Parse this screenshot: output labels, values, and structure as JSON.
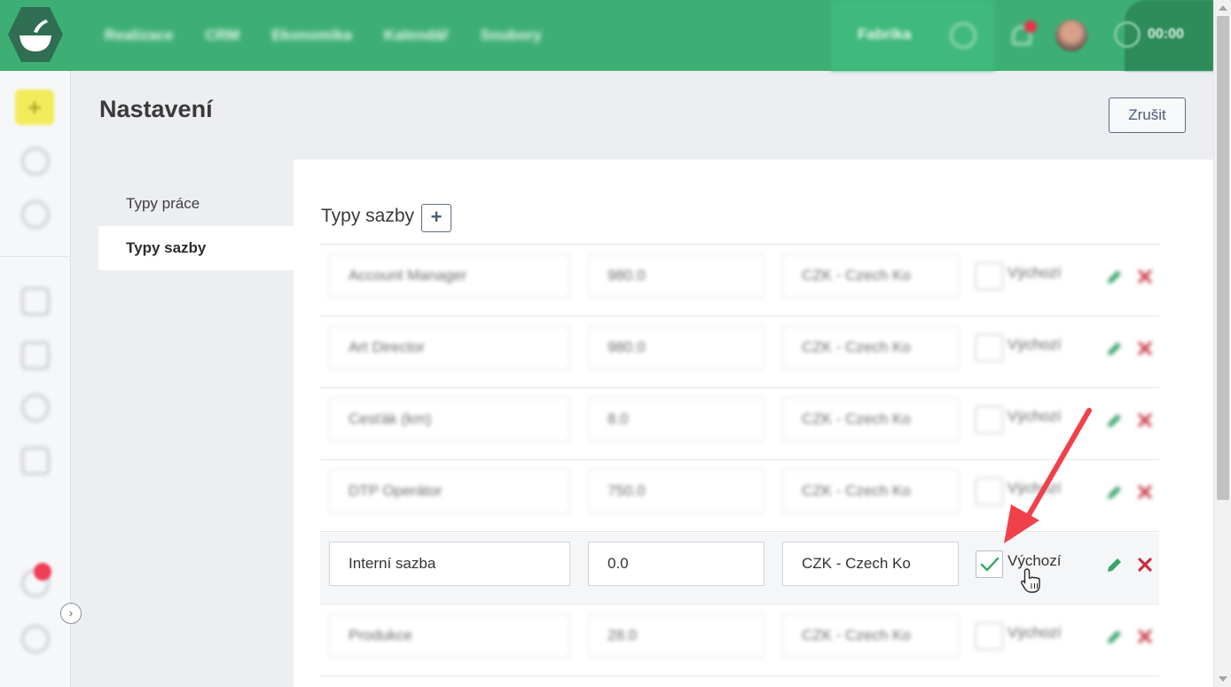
{
  "topbar": {
    "nav": [
      "Realizace",
      "CRM",
      "Ekonomika",
      "Kalendář",
      "Soubory"
    ],
    "company": "Fabrika",
    "timer": "00:00"
  },
  "page": {
    "title": "Nastavení",
    "cancel_label": "Zrušit"
  },
  "subnav": {
    "items": [
      {
        "label": "Typy práce",
        "active": false
      },
      {
        "label": "Typy sazby",
        "active": true
      }
    ]
  },
  "section": {
    "title": "Typy sazby",
    "add_label": "+"
  },
  "rates": [
    {
      "name": "Account Manager",
      "price": "980.0",
      "currency": "CZK - Czech Ko",
      "default_label": "Výchozí",
      "checked": false
    },
    {
      "name": "Art Director",
      "price": "980.0",
      "currency": "CZK - Czech Ko",
      "default_label": "Výchozí",
      "checked": false
    },
    {
      "name": "Cesťák (km)",
      "price": "8.0",
      "currency": "CZK - Czech Ko",
      "default_label": "Výchozí",
      "checked": false
    },
    {
      "name": "DTP Operátor",
      "price": "750.0",
      "currency": "CZK - Czech Ko",
      "default_label": "Výchozí",
      "checked": false
    },
    {
      "name": "Interní sazba",
      "price": "0.0",
      "currency": "CZK - Czech Ko",
      "default_label": "Výchozí",
      "checked": true
    },
    {
      "name": "Produkce",
      "price": "28.0",
      "currency": "CZK - Czech Ko",
      "default_label": "Výchozí",
      "checked": false
    }
  ],
  "colors": {
    "brand_green": "#3daf74",
    "edit_green": "#3aa56a",
    "delete_red": "#c8313f",
    "arrow_red": "#f0414b"
  }
}
